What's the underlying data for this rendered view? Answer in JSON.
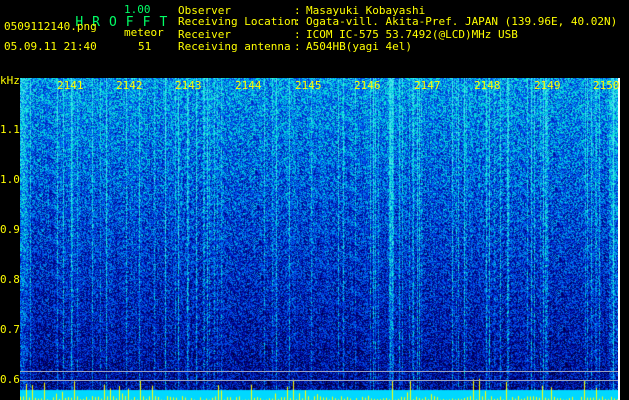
{
  "app": {
    "title_letters": [
      "H",
      "R",
      "O",
      "F",
      "F",
      "T"
    ],
    "version": "1.00",
    "filename": "0509112140.png",
    "datetime": "05.09.11 21:40",
    "category_label": "meteor",
    "category_count": "51"
  },
  "info": {
    "rows": [
      {
        "label": "Observer",
        "sep": ":",
        "value": "Masayuki Kobayashi"
      },
      {
        "label": "Receiving Location",
        "sep": ":",
        "value": "Ogata-vill. Akita-Pref. JAPAN (139.96E, 40.02N)"
      },
      {
        "label": "Receiver",
        "sep": ":",
        "value": "ICOM IC-575 53.7492(@LCD)MHz USB"
      },
      {
        "label": "Receiving antenna",
        "sep": ":",
        "value": "A504HB(yagi 4el)"
      }
    ]
  },
  "axes": {
    "y_unit": "kHz",
    "y_ticks": [
      "1.1",
      "1.0",
      "0.9",
      "0.8",
      "0.7",
      "0.6"
    ],
    "x_ticks": [
      "2141",
      "2142",
      "2143",
      "2144",
      "2145",
      "2146",
      "2147",
      "2148",
      "2149",
      "2150"
    ]
  },
  "colors": {
    "label_yellow": "#ffff00",
    "title_green": "#00ff66",
    "background": "#000000"
  }
}
